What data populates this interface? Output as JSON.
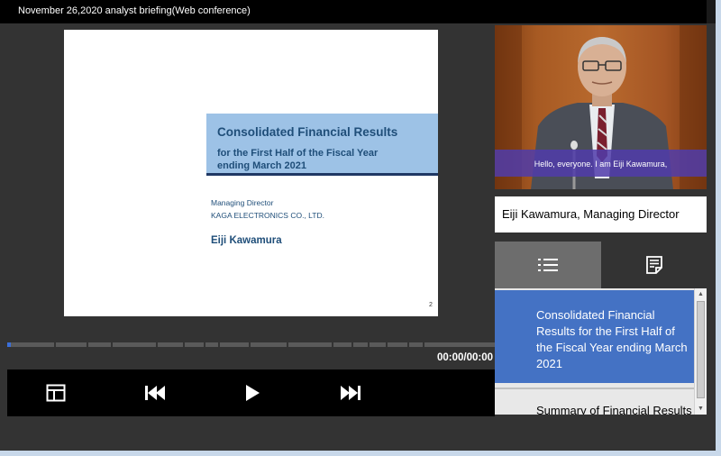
{
  "window": {
    "title": "November 26,2020 analyst briefing(Web conference)"
  },
  "slide": {
    "title": "Consolidated Financial Results",
    "subtitle_line1": "for the First Half of the Fiscal Year",
    "subtitle_line2": "ending March 2021",
    "role": "Managing Director",
    "company": "KAGA ELECTRONICS CO., LTD.",
    "presenter": "Eiji Kawamura",
    "page_number": "2"
  },
  "player": {
    "time": "00:00/00:00",
    "progress": 0.0,
    "buttons": {
      "layout": "layout-icon",
      "previous": "skip-previous-icon",
      "play": "play-icon",
      "next": "skip-next-icon"
    }
  },
  "video": {
    "caption": "Hello, everyone. I am Eiji Kawamura,"
  },
  "speaker": {
    "name": "Eiji Kawamura, Managing Director"
  },
  "tabs": [
    {
      "icon": "list-icon",
      "active": true
    },
    {
      "icon": "notes-icon",
      "active": false
    }
  ],
  "toc": {
    "items": [
      {
        "label": "Consolidated Financial Results for the First Half of the Fiscal Year ending March 2021",
        "selected": true
      },
      {
        "label": "Summary of Financial Results",
        "selected": false
      }
    ]
  },
  "colors": {
    "accent": "#4472c4",
    "slide_band": "#9dc2e6",
    "caption_band": "#503caa"
  }
}
